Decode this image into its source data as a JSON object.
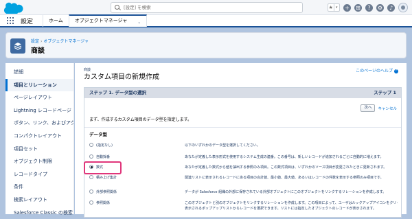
{
  "header": {
    "search_placeholder": "[設定] を検索",
    "fav_star": "★",
    "fav_caret": "▾",
    "icons": [
      "plus-icon",
      "setup-icon",
      "help-icon",
      "gear-icon",
      "bell-icon",
      "avatar"
    ],
    "icon_glyphs": {
      "plus": "+",
      "setup": "⊞",
      "help": "?",
      "gear": "⚙",
      "bell": "♪"
    }
  },
  "nav": {
    "app_name": "設定",
    "tabs": [
      {
        "label": "ホーム"
      },
      {
        "label": "オブジェクトマネージャ"
      }
    ],
    "active_tab_chevron": "⌄"
  },
  "page_header": {
    "breadcrumb_1": "設定",
    "breadcrumb_sep": "›",
    "breadcrumb_2": "オブジェクトマネージャ",
    "title": "商談"
  },
  "sidebar": {
    "items": [
      {
        "label": "詳細"
      },
      {
        "label": "項目とリレーション"
      },
      {
        "label": "ページレイアウト"
      },
      {
        "label": "Lightning レコードページ"
      },
      {
        "label": "ボタン、リンク、およびアクション"
      },
      {
        "label": "コンパクトレイアウト"
      },
      {
        "label": "項目セット"
      },
      {
        "label": "オブジェクト制限"
      },
      {
        "label": "レコードタイプ"
      },
      {
        "label": "条件"
      },
      {
        "label": "検索レイアウト"
      },
      {
        "label": "Salesforce Classic の検索レイ"
      }
    ],
    "active_index": 1
  },
  "main": {
    "object_label": "商談",
    "title": "カスタム項目の新規作成",
    "help_link": "このページのヘルプ",
    "help_glyph": "?",
    "step_title": "ステップ 1. データ型の選択",
    "step_counter": "ステップ 1",
    "next_button": "次へ",
    "cancel_link": "キャンセル",
    "intro_text": "まず、作成するカスタム項目のデータ型を指定します。",
    "section_title": "データ型",
    "options": [
      {
        "label": "(指定なし)",
        "desc": "以下のいずれかのデータ型を選択してください。",
        "desc2": "",
        "selected": false
      },
      {
        "label": "自動採番",
        "desc": "あなたが定義した表示形式を使用するシステム生成の連番。この番号は、新しいレコードが追加されるごとに自動的に増えます。",
        "desc2": "",
        "selected": false
      },
      {
        "label": "数式",
        "desc": "あなたが定義した数式から値を抽出する参照のみ項目。この数式項目は、いずれかのソース項目が変更されたときに更新されます。",
        "desc2": "",
        "selected": true
      },
      {
        "label": "積み上げ集計",
        "desc": "関連リストに表示されるレコードにある項目の合計値、最小値、最大値、あるいはレコードの件数を表示する参照のみ項目です。",
        "desc2": "",
        "selected": false
      },
      {
        "label": "外部参照関係",
        "desc": "データが Salesforce 組織の外部に保存されている外部オブジェクトにこのオブジェクトをリンクするリレーションを作成します。",
        "desc2": "",
        "selected": false
      },
      {
        "label": "参照関係",
        "desc": "このオブジェクトと別のオブジェクトをリンクするリレーションを作成します。この項目によって、ユーザはルックアップアイコンをクリックして",
        "desc2": "表示されるポップアップリストからレコードを選択できます。リストには指定したオブジェクトのレコードが表示されます。",
        "selected": false
      }
    ]
  },
  "colors": {
    "brand_blue": "#1b5297",
    "link": "#0070d2",
    "highlight": "#e0357a",
    "background": "#b0c4df"
  }
}
